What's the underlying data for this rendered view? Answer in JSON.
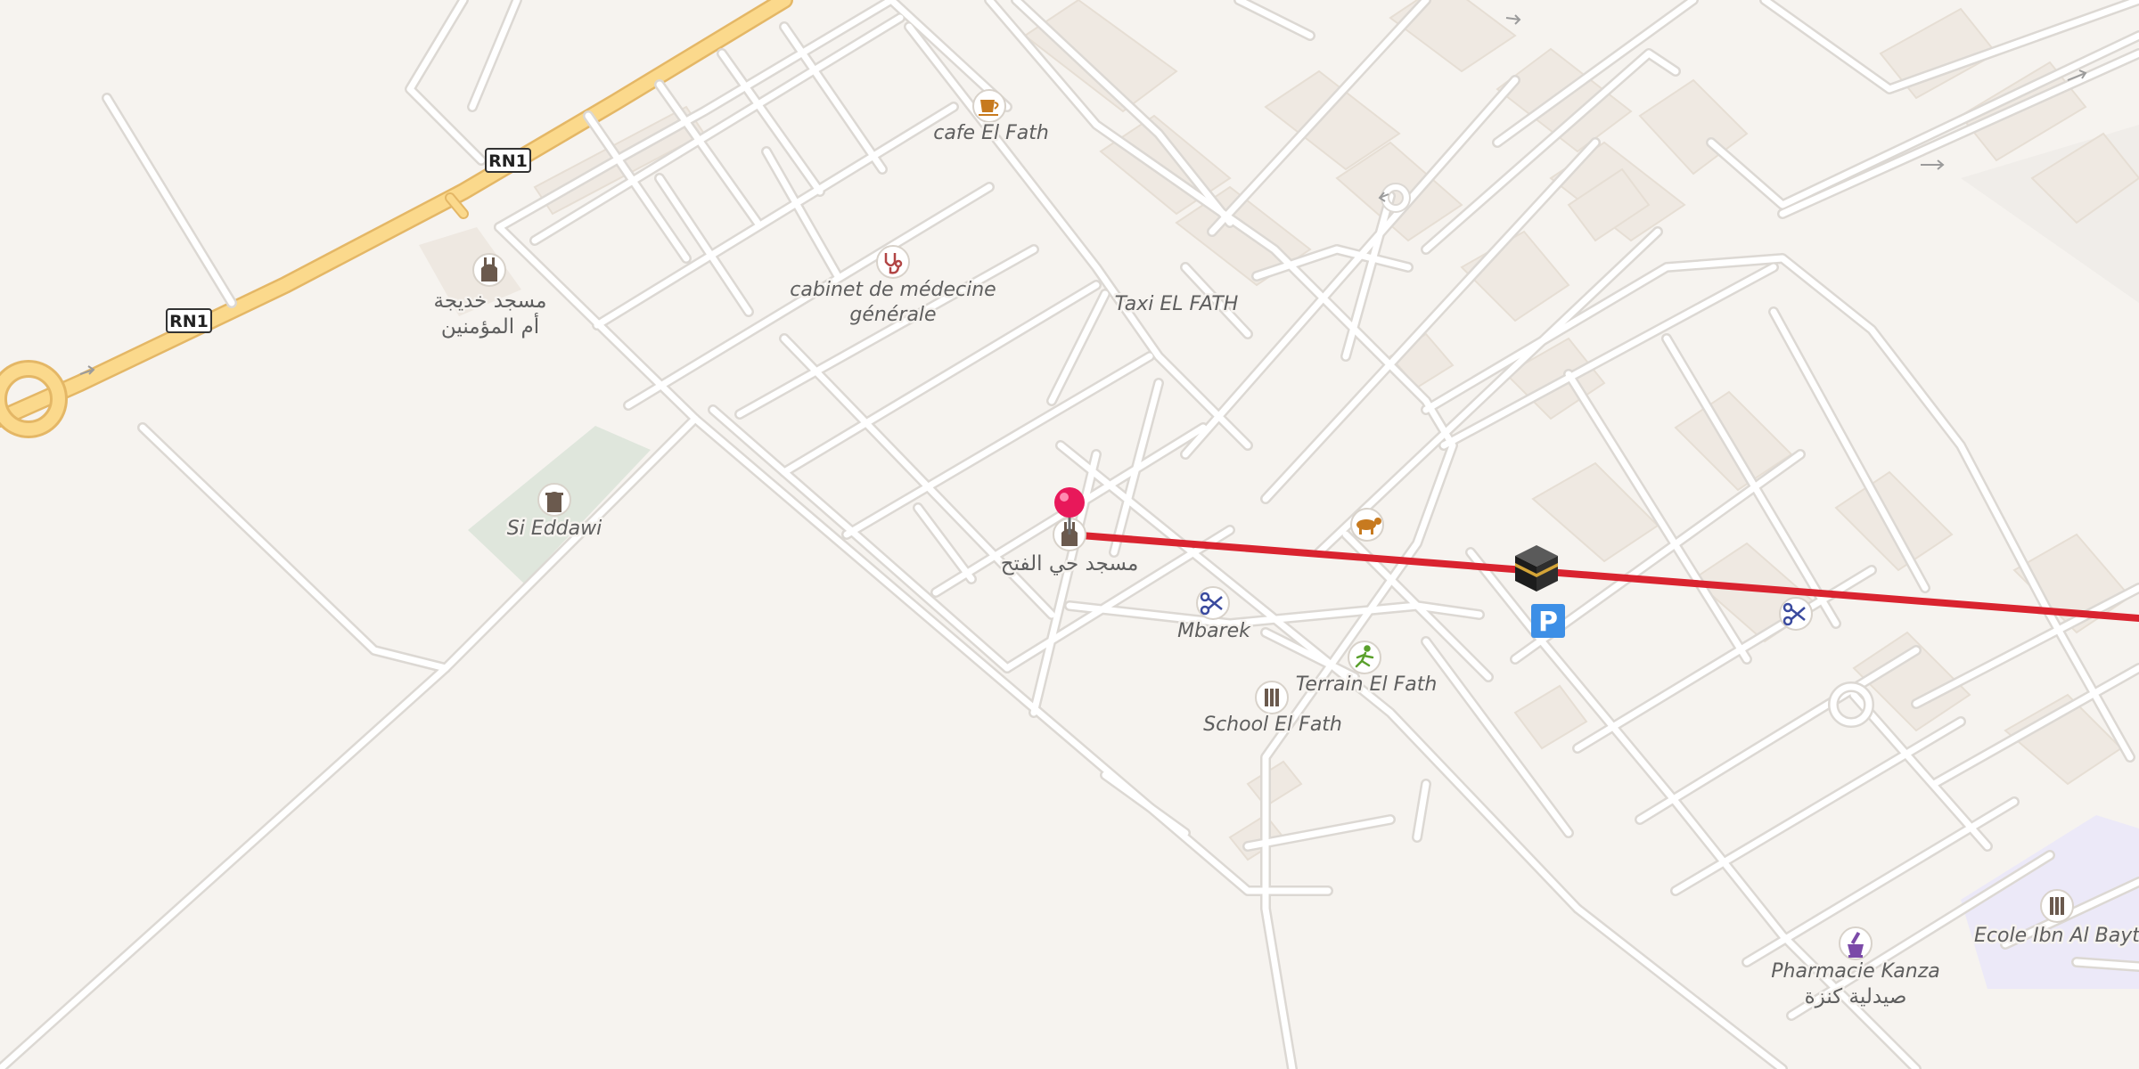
{
  "map": {
    "colors": {
      "background": "#f6f3ef",
      "road": "#ffffff",
      "road_casing": "#dcd8d3",
      "highway": "#fbd98c",
      "highway_casing": "#e4b766",
      "block": "#efe9e2",
      "park": "#dfe6dc",
      "school_area": "#ece9f8",
      "route_line": "#d9232f",
      "pin": "#e8185a",
      "parking": "#3d8fe6"
    },
    "road_shields": [
      {
        "name": "rn1-shield-north",
        "text": "RN1"
      },
      {
        "name": "rn1-shield-south",
        "text": "RN1"
      }
    ],
    "pois": {
      "cafe": {
        "label": "cafe El Fath",
        "icon": "cafe-icon"
      },
      "clinic": {
        "label_line1": "cabinet de médecine",
        "label_line2": "générale",
        "icon": "doctor-icon"
      },
      "taxi": {
        "label": "Taxi EL FATH"
      },
      "mosque_khadija": {
        "label_line1": "مسجد خديجة",
        "label_line2": "أم المؤمنين",
        "icon": "mosque-icon"
      },
      "cemetery": {
        "label": "Si Eddawi",
        "icon": "cemetery-icon"
      },
      "mosque_fath": {
        "label": "مسجد حي الفتح",
        "icon": "mosque-icon"
      },
      "barber_mbarek": {
        "label": "Mbarek",
        "icon": "scissors-icon"
      },
      "terrain": {
        "label": "Terrain El Fath",
        "icon": "sports-icon"
      },
      "school": {
        "label": "School El Fath",
        "icon": "school-icon"
      },
      "butcher": {
        "icon": "butcher-icon"
      },
      "kaaba": {
        "icon": "kaaba-icon"
      },
      "parking": {
        "label": "P",
        "icon": "parking-icon"
      },
      "barber_east": {
        "icon": "scissors-icon"
      },
      "ecole": {
        "label": "Ecole Ibn Al Baytar",
        "icon": "school-icon"
      },
      "pharmacy": {
        "label_line1": "Pharmacie Kanza",
        "label_line2": "صيدلية كنزة",
        "icon": "pharmacy-icon"
      }
    },
    "marker": {
      "icon": "location-pin-icon"
    },
    "route": {
      "icon": "route-line"
    }
  }
}
